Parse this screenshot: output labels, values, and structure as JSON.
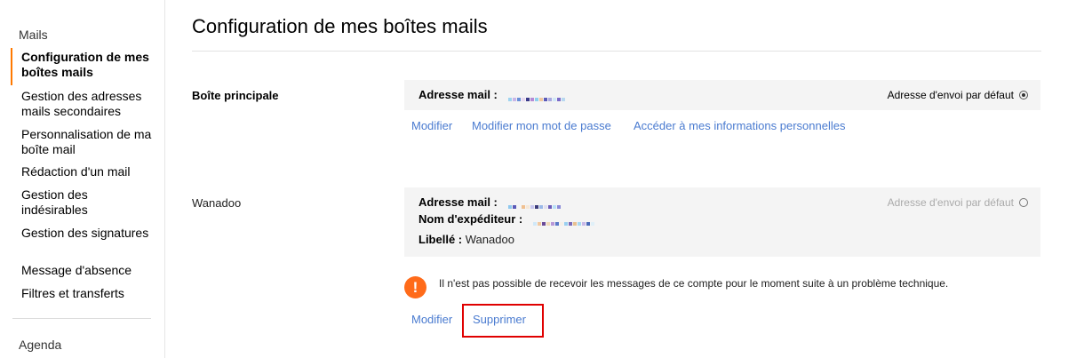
{
  "sidebar": {
    "section_mails": "Mails",
    "items": [
      {
        "label": "Configuration de mes boîtes mails"
      },
      {
        "label": "Gestion des adresses mails secondaires"
      },
      {
        "label": "Personnalisation de ma boîte mail"
      },
      {
        "label": "Rédaction d'un mail"
      },
      {
        "label": "Gestion des indésirables"
      },
      {
        "label": "Gestion des signatures"
      },
      {
        "label": "Message d'absence"
      },
      {
        "label": "Filtres et transferts"
      }
    ],
    "section_agenda": "Agenda"
  },
  "page": {
    "title": "Configuration de mes boîtes mails"
  },
  "accounts": {
    "main": {
      "label": "Boîte principale",
      "address_label": "Adresse mail :",
      "default_label": "Adresse d'envoi par défaut",
      "links": {
        "modify": "Modifier",
        "change_password": "Modifier mon mot de passe",
        "personal_info": "Accéder à mes informations personnelles"
      }
    },
    "wanadoo": {
      "label": "Wanadoo",
      "address_label": "Adresse mail :",
      "sender_label": "Nom d'expéditeur :",
      "tag_label": "Libellé :",
      "tag_value": "Wanadoo",
      "default_label": "Adresse d'envoi par défaut",
      "alert": "Il n'est pas possible de recevoir les messages de ce compte pour le moment suite à un problème technique.",
      "links": {
        "modify": "Modifier",
        "delete": "Supprimer"
      }
    }
  },
  "colors": {
    "accent": "#ff7900",
    "link": "#4a7bd0",
    "alert": "#ff6b1a",
    "highlight": "#e00000"
  }
}
